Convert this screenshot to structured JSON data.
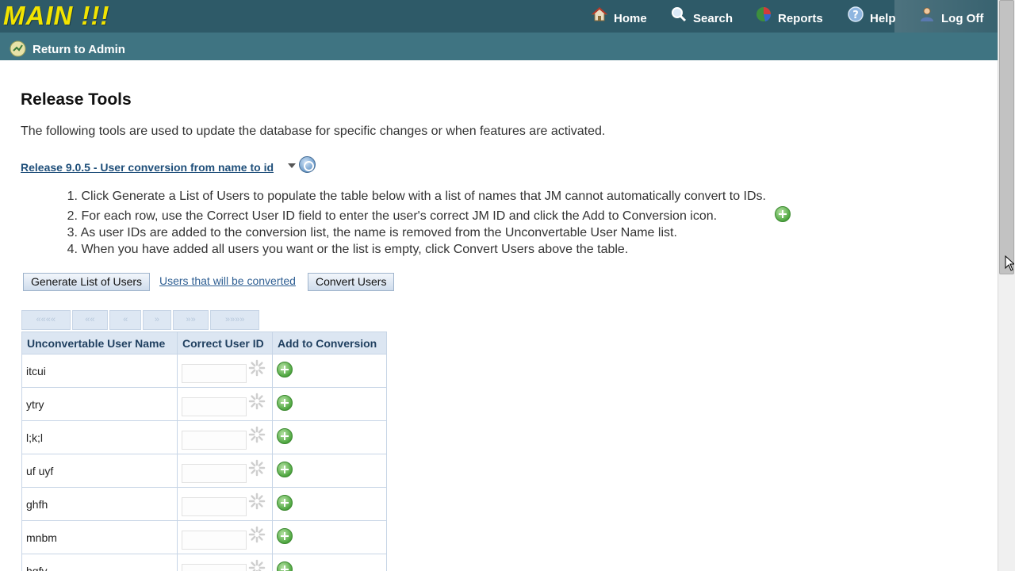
{
  "header": {
    "logo": "MAIN !!!",
    "nav": [
      {
        "label": "Home",
        "icon": "home-icon"
      },
      {
        "label": "Search",
        "icon": "search-icon"
      },
      {
        "label": "Reports",
        "icon": "reports-icon"
      },
      {
        "label": "Help",
        "icon": "help-icon"
      },
      {
        "label": "Log Off",
        "icon": "user-icon"
      }
    ],
    "return_label": "Return to Admin"
  },
  "content": {
    "title": "Release Tools",
    "intro": "The following tools are used to update the database for specific changes or when features are activated.",
    "release_link": "Release 9.0.5 - User conversion from name to id",
    "steps": [
      {
        "num": "1.",
        "text": "Click Generate a List of Users to populate the table below with a list of names that JM cannot automatically convert to IDs."
      },
      {
        "num": "2.",
        "text": "For each row, use the Correct User ID field to enter the user's correct JM ID and click the Add to Conversion icon."
      },
      {
        "num": "3.",
        "text": "As user IDs are added to the conversion list, the name is removed from the Unconvertable User Name list."
      },
      {
        "num": "4.",
        "text": "When you have added all users you want or the list is empty, click Convert Users above the table."
      }
    ],
    "buttons": {
      "generate": "Generate List of Users",
      "users_link": "Users that will be converted",
      "convert": "Convert Users"
    },
    "pager": [
      "««««",
      "««",
      "«",
      "»",
      "»»",
      "»»»»"
    ],
    "table": {
      "headers": [
        "Unconvertable User Name",
        "Correct User ID",
        "Add to Conversion"
      ],
      "rows": [
        "itcui",
        "ytry",
        "l;k;l",
        "uf uyf",
        "ghfh",
        "mnbm",
        "hgfy"
      ]
    }
  },
  "colors": {
    "header_bg": "#2e5a68",
    "subbar_bg": "#3f7482",
    "logo": "#f2e400",
    "link": "#1f4f7a"
  }
}
